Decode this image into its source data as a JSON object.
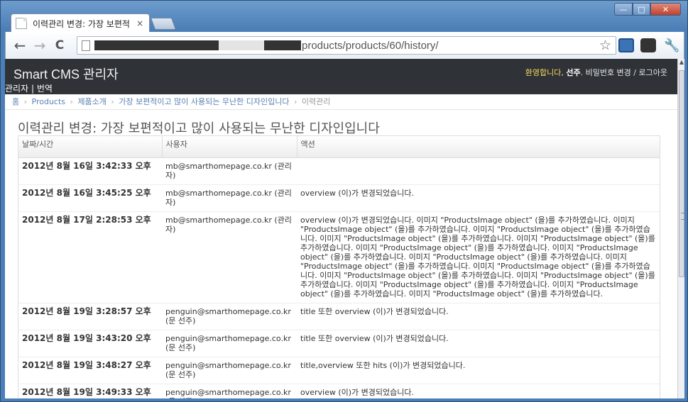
{
  "browser": {
    "tab_title": "이력관리 변경: 가장 보편적",
    "tab_close": "×",
    "url_visible": "products/products/60/history/",
    "star": "☆",
    "back": "←",
    "forward": "→",
    "reload": "C",
    "wrench": "🔧",
    "win_min": "—",
    "win_max": "□",
    "win_close": "✕"
  },
  "header": {
    "brand": "Smart CMS 관리자",
    "welcome": "환영합니다,",
    "username": "선주",
    "dot": ".",
    "change_password": "비밀번호 변경",
    "slash": "/",
    "logout": "로그아웃",
    "subnav_admin": "관리자",
    "subnav_sep": "|",
    "subnav_translate": "번역"
  },
  "breadcrumbs": {
    "home": "홈",
    "products": "Products",
    "category": "제품소개",
    "item": "가장 보편적이고 많이 사용되는 무난한 디자인입니다",
    "current": "이력관리",
    "sep": "›"
  },
  "page_title": "이력관리 변경: 가장 보편적이고 많이 사용되는 무난한 디자인입니다",
  "table": {
    "columns": [
      "날짜/시간",
      "사용자",
      "액션"
    ],
    "rows": [
      {
        "date": "2012년 8월 16일 3:42:33 오후",
        "user": "mb@smarthomepage.co.kr (관리자)",
        "action": ""
      },
      {
        "date": "2012년 8월 16일 3:45:25 오후",
        "user": "mb@smarthomepage.co.kr (관리자)",
        "action": "overview (이)가 변경되었습니다."
      },
      {
        "date": "2012년 8월 17일 2:28:53 오후",
        "user": "mb@smarthomepage.co.kr (관리자)",
        "action": "overview (이)가 변경되었습니다. 이미지 \"ProductsImage object\" (을)를 추가하였습니다. 이미지 \"ProductsImage object\" (을)를 추가하였습니다. 이미지 \"ProductsImage object\" (을)를 추가하였습니다. 이미지 \"ProductsImage object\" (을)를 추가하였습니다. 이미지 \"ProductsImage object\" (을)를 추가하였습니다. 이미지 \"ProductsImage object\" (을)를 추가하였습니다. 이미지 \"ProductsImage object\" (을)를 추가하였습니다. 이미지 \"ProductsImage object\" (을)를 추가하였습니다. 이미지 \"ProductsImage object\" (을)를 추가하였습니다. 이미지 \"ProductsImage object\" (을)를 추가하였습니다. 이미지 \"ProductsImage object\" (을)를 추가하였습니다. 이미지 \"ProductsImage object\" (을)를 추가하였습니다. 이미지 \"ProductsImage object\" (을)를 추가하였습니다. 이미지 \"ProductsImage object\" (을)를 추가하였습니다. 이미지 \"ProductsImage object\" (을)를 추가하였습니다."
      },
      {
        "date": "2012년 8월 19일 3:28:57 오후",
        "user": "penguin@smarthomepage.co.kr (문 선주)",
        "action": "title 또한 overview (이)가 변경되었습니다."
      },
      {
        "date": "2012년 8월 19일 3:43:20 오후",
        "user": "penguin@smarthomepage.co.kr (문 선주)",
        "action": "title 또한 overview (이)가 변경되었습니다."
      },
      {
        "date": "2012년 8월 19일 3:48:27 오후",
        "user": "penguin@smarthomepage.co.kr (문 선주)",
        "action": "title,overview 또한 hits (이)가 변경되었습니다."
      },
      {
        "date": "2012년 8월 19일 3:49:33 오후",
        "user": "penguin@smarthomepage.co.kr (문 선주)",
        "action": "overview (이)가 변경되었습니다."
      }
    ]
  }
}
